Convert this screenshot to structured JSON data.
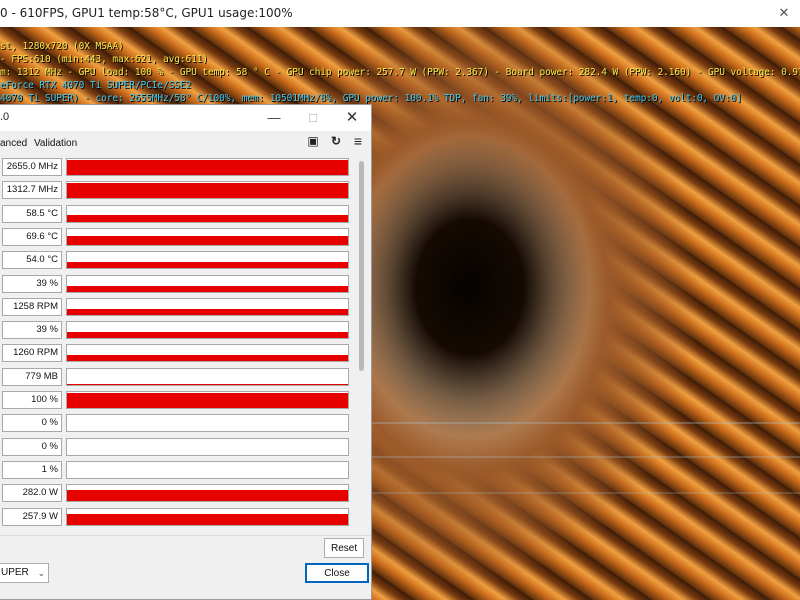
{
  "app": {
    "title": "0 - 610FPS, GPU1 temp:58°C, GPU1 usage:100%",
    "close_glyph": "✕"
  },
  "osd": {
    "line1": "st, 1280x720 (0X MSAA)",
    "line2": "- FPS:610 (min:443, max:621, avg:611)",
    "line3": "m: 1312 MHz - GPU load: 100 % - GPU temp: 58 ° C - GPU chip power: 257.7 W (PPW: 2.367) - Board power: 282.4 W (PPW: 2.160) - GPU voltage: 0.970 V",
    "line4": "eForce RTX 4070 Ti SUPER/PCIe/SSE2",
    "line5": "4070 Ti SUPER) - core: 2655MHz/58° C/100%, mem: 10501MHz/8%, GPU power: 100.1% TDP, fan: 39%, limits:[power:1, temp:0, volt:0, OV:0]"
  },
  "sensor_window": {
    "title": ".0",
    "tabs": {
      "advanced": "anced",
      "validation": "Validation"
    },
    "icons": {
      "camera": "camera-icon",
      "refresh": "refresh-icon",
      "menu": "menu-icon"
    },
    "sensors": [
      {
        "value": "2655.0 MHz",
        "level": 0.95
      },
      {
        "value": "1312.7 MHz",
        "level": 0.95
      },
      {
        "value": "58.5 °C",
        "level": 0.45
      },
      {
        "value": "69.6 °C",
        "level": 0.55
      },
      {
        "value": "54.0 °C",
        "level": 0.4
      },
      {
        "value": "39 %",
        "level": 0.35
      },
      {
        "value": "1258 RPM",
        "level": 0.35
      },
      {
        "value": "39 %",
        "level": 0.35
      },
      {
        "value": "1260 RPM",
        "level": 0.35
      },
      {
        "value": "779 MB",
        "level": 0.08
      },
      {
        "value": "100 %",
        "level": 0.95
      },
      {
        "value": "0 %",
        "level": 0.0
      },
      {
        "value": "0 %",
        "level": 0.0
      },
      {
        "value": "1 %",
        "level": 0.0
      },
      {
        "value": "282.0 W",
        "level": 0.7
      },
      {
        "value": "257.9 W",
        "level": 0.7
      }
    ],
    "reset_label": "Reset",
    "close_label": "Close",
    "gpu_selected": "UPER"
  },
  "colors": {
    "graph": "#e60000",
    "osd_yellow": "#f7e84a",
    "osd_cyan": "#43c8ee"
  }
}
